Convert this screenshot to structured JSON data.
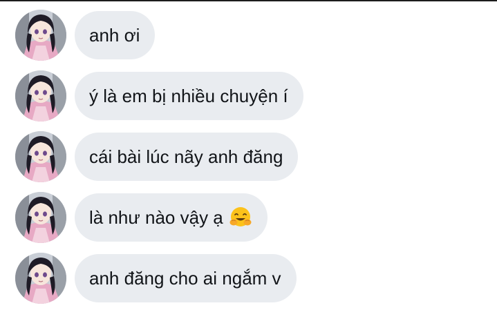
{
  "messages": [
    {
      "text": "anh ơi",
      "emoji": null
    },
    {
      "text": "ý là em bị nhiều chuyện í",
      "emoji": null
    },
    {
      "text": "cái bài lúc nãy anh đăng",
      "emoji": null
    },
    {
      "text": "là như nào vậy ạ",
      "emoji": "hugging-face-icon"
    },
    {
      "text": "anh đăng cho ai ngắm v",
      "emoji": null
    }
  ],
  "colors": {
    "bubble_bg": "#e9ecf0",
    "text": "#111418",
    "top_border": "#1c1c1c"
  }
}
